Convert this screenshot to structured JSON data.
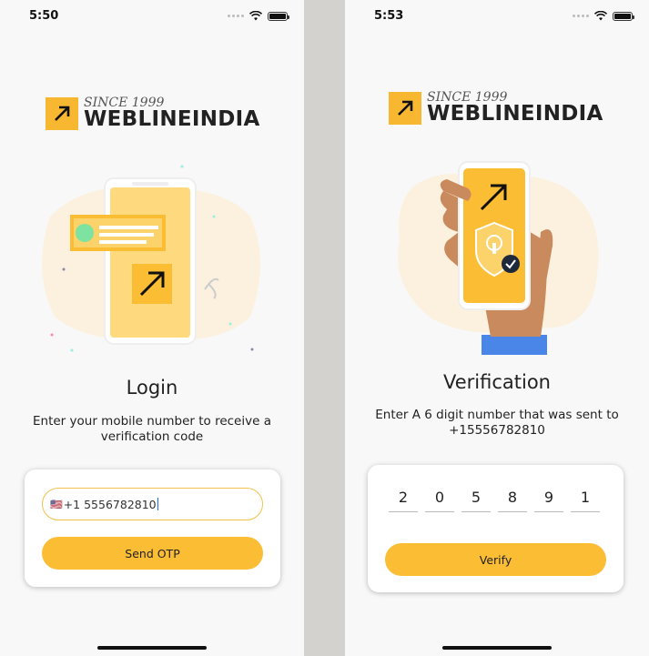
{
  "login": {
    "status_time": "5:50",
    "logo": {
      "since": "SINCE 1999",
      "brand": "WEBLINEINDIA"
    },
    "title": "Login",
    "subtitle": "Enter your mobile number to receive a verification code",
    "phone_flag": "🇺🇸",
    "phone_value": "+1 5556782810",
    "send_button": "Send OTP"
  },
  "verify": {
    "status_time": "5:53",
    "logo": {
      "since": "SINCE 1999",
      "brand": "WEBLINEINDIA"
    },
    "title": "Verification",
    "subtitle_line1": "Enter A 6 digit number that was sent to",
    "subtitle_line2": "+15556782810",
    "otp": [
      "2",
      "0",
      "5",
      "8",
      "9",
      "1"
    ],
    "verify_button": "Verify"
  },
  "colors": {
    "accent": "#fbbd34",
    "brand_box": "#f7b731"
  },
  "icons": [
    "wifi-icon",
    "battery-icon",
    "signal-dots-icon",
    "arrow-up-right-icon",
    "shield-lock-icon",
    "check-icon"
  ]
}
